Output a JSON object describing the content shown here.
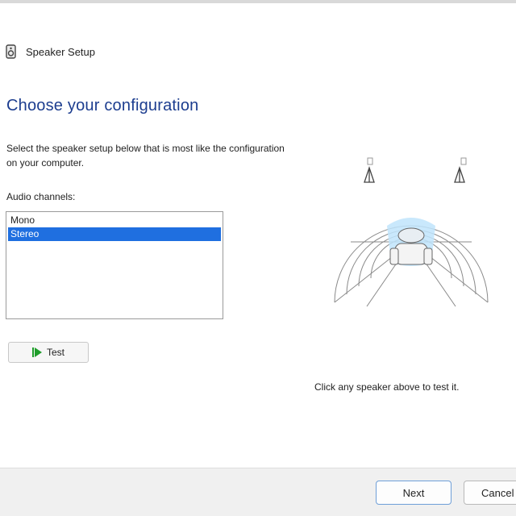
{
  "window": {
    "title": "Speaker Setup"
  },
  "page": {
    "heading": "Choose your configuration",
    "description": "Select the speaker setup below that is most like the configuration on your computer.",
    "list_label": "Audio channels:",
    "hint": "Click any speaker above to test it."
  },
  "audio_channels": {
    "items": [
      {
        "label": "Mono",
        "selected": false
      },
      {
        "label": "Stereo",
        "selected": true
      }
    ]
  },
  "buttons": {
    "test_label": "Test",
    "next_label": "Next",
    "cancel_label": "Cancel"
  },
  "diagram": {
    "speakers": [
      "left-speaker",
      "right-speaker"
    ],
    "listener": "listener"
  },
  "colors": {
    "heading": "#1c3d8f",
    "selection": "#1f6fe0",
    "play_green": "#1f9d2a",
    "sound_field": "#bfe4fb"
  }
}
